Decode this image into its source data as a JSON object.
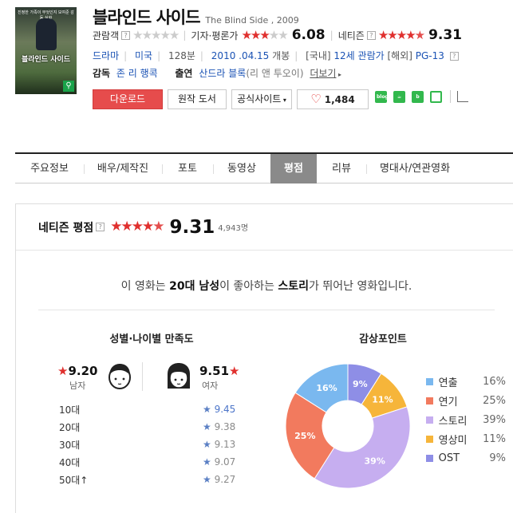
{
  "movie": {
    "title_ko": "블라인드 사이드",
    "title_en": "The Blind Side , 2009",
    "poster_title": "블라인드 사이드",
    "poster_top": "진정한 가족이 무엇인지 보여준 감동 실화"
  },
  "ratings": {
    "audience_label": "관람객",
    "critics_label": "기자·평론가",
    "critics_score": "6.08",
    "netizen_label": "네티즌",
    "netizen_score": "9.31"
  },
  "info": {
    "genre": "드라마",
    "country": "미국",
    "runtime": "128분",
    "release": "2010 .04.15",
    "release_suffix": "개봉",
    "domestic_label": "[국내]",
    "domestic_rating": "12세 관람가",
    "overseas_label": "[해외]",
    "overseas_rating": "PG-13"
  },
  "credits": {
    "director_label": "감독",
    "director": "존 리 행콕",
    "cast_label": "출연",
    "cast": "산드라 블록",
    "cast_role": "(리 앤 투오이)",
    "more": "더보기"
  },
  "buttons": {
    "download": "다운로드",
    "original_book": "원작 도서",
    "official_site": "공식사이트",
    "like_count": "1,484"
  },
  "share_icons": [
    "blog",
    "cafe",
    "band",
    "line"
  ],
  "tabs": [
    {
      "label": "주요정보",
      "active": false
    },
    {
      "label": "배우/제작진",
      "active": false
    },
    {
      "label": "포토",
      "active": false
    },
    {
      "label": "동영상",
      "active": false
    },
    {
      "label": "평점",
      "active": true
    },
    {
      "label": "리뷰",
      "active": false
    },
    {
      "label": "명대사/연관영화",
      "active": false
    }
  ],
  "rating_panel": {
    "header_label": "네티즌 평점",
    "score": "9.31",
    "count": "4,943명",
    "summary_pre": "이 영화는 ",
    "summary_group": "20대 남성",
    "summary_mid": "이 좋아하는 ",
    "summary_point": "스토리",
    "summary_post": "가 뛰어난 영화입니다.",
    "gender_title": "성별·나이별 만족도",
    "point_title": "감상포인트",
    "male_score": "9.20",
    "male_label": "남자",
    "female_score": "9.51",
    "female_label": "여자",
    "ages": [
      {
        "label": "10대",
        "score": 9.45,
        "score_text": "9.45",
        "top": true
      },
      {
        "label": "20대",
        "score": 9.38,
        "score_text": "9.38",
        "top": false
      },
      {
        "label": "30대",
        "score": 9.13,
        "score_text": "9.13",
        "top": false
      },
      {
        "label": "40대",
        "score": 9.07,
        "score_text": "9.07",
        "top": false
      },
      {
        "label": "50대↑",
        "score": 9.27,
        "score_text": "9.27",
        "top": false
      }
    ]
  },
  "chart_data": {
    "type": "pie",
    "donut": true,
    "categories": [
      "연출",
      "연기",
      "스토리",
      "영상미",
      "OST"
    ],
    "values": [
      16,
      25,
      39,
      11,
      9
    ],
    "labels": [
      "16%",
      "25%",
      "39%",
      "11%",
      "9%"
    ],
    "colors": [
      "#7ab8ef",
      "#f27a5e",
      "#c6aef0",
      "#f6b53a",
      "#8e8ee6"
    ],
    "legend": "right"
  },
  "colors": {
    "red_star": "#e0302e",
    "link_blue": "#1a52b4",
    "bar_top": "#5581d8",
    "bar": "#b4c6e6"
  }
}
